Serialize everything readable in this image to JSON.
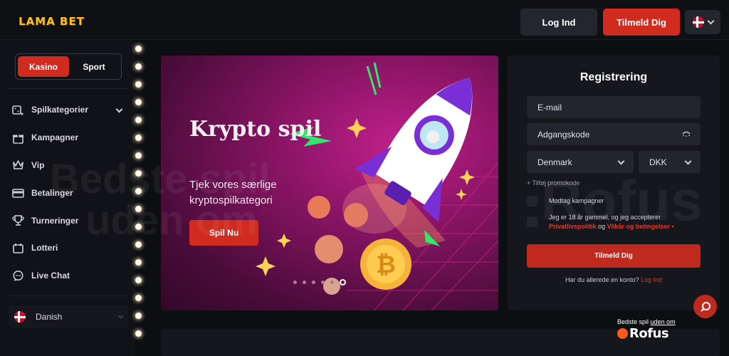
{
  "header": {
    "logo_text": "LAMA BET",
    "login_label": "Log Ind",
    "signup_label": "Tilmeld Dig",
    "language_flag": "danish-flag-icon"
  },
  "sidebar": {
    "toggle": {
      "active": "Kasino",
      "inactive": "Sport"
    },
    "items": [
      {
        "label": "Spilkategorier",
        "icon": "dice-icon",
        "has_caret": true
      },
      {
        "label": "Kampagner",
        "icon": "gift-icon"
      },
      {
        "label": "Vip",
        "icon": "crown-icon"
      },
      {
        "label": "Betalinger",
        "icon": "wallet-icon"
      },
      {
        "label": "Turneringer",
        "icon": "trophy-icon"
      },
      {
        "label": "Lotteri",
        "icon": "ticket-icon"
      },
      {
        "label": "Live Chat",
        "icon": "chat-icon"
      }
    ],
    "language": "Danish"
  },
  "hero": {
    "title": "Krypto spil",
    "subtitle": "Tjek vores særlige kryptospilkategori",
    "button_label": "Spil Nu",
    "slides_count": 6,
    "active_slide": 6
  },
  "registration": {
    "title": "Registrering",
    "email_placeholder": "E-mail",
    "password_placeholder": "Adgangskode",
    "country": "Denmark",
    "currency": "DKK",
    "promo_label": "+ Tilføj promokode",
    "consent_campaigns": "Modtag kampagner",
    "consent_age_text": "Jeg er 18 år gammel, og jeg accepterer",
    "privacy_link": "Privatlivspolitik",
    "and_text": "og",
    "terms_link": "Vilkår og betingelser",
    "required_mark": "•",
    "submit_label": "Tilmeld Dig",
    "already_text": "Har du allerede en konto?",
    "login_link": "Log Ind"
  },
  "watermark": {
    "line1": "Bedste spil",
    "line2": "uden om",
    "brand": "Rofus"
  },
  "badge": {
    "top_a": "Bedste spil",
    "top_b": "uden om",
    "brand": "Rofus"
  },
  "colors": {
    "accent": "#d12a1e",
    "background": "#0d0e12",
    "panel": "#16171c",
    "logo": "#f4c21b"
  }
}
